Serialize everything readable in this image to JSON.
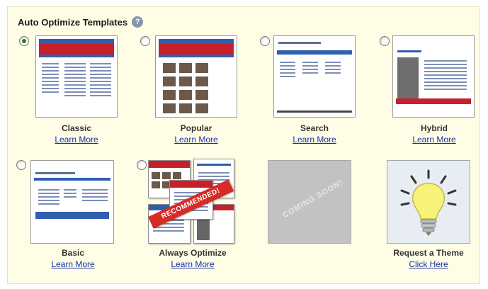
{
  "panel": {
    "title": "Auto Optimize Templates",
    "help_icon_glyph": "?"
  },
  "templates": [
    {
      "name": "Classic",
      "link": "Learn More",
      "selected": true
    },
    {
      "name": "Popular",
      "link": "Learn More",
      "selected": false
    },
    {
      "name": "Search",
      "link": "Learn More",
      "selected": false
    },
    {
      "name": "Hybrid",
      "link": "Learn More",
      "selected": false
    },
    {
      "name": "Basic",
      "link": "Learn More",
      "selected": false
    },
    {
      "name": "Always Optimize",
      "link": "Learn More",
      "selected": false,
      "ribbon": "RECOMMENDED!"
    },
    {
      "name": "",
      "link": "",
      "placeholder": "COMING SOON!"
    },
    {
      "name": "Request a Theme",
      "link": "Click Here"
    }
  ],
  "colors": {
    "panel_bg": "#fffde6",
    "link": "#1533a8",
    "header_red": "#c8202b",
    "header_blue": "#2f5fae",
    "ribbon_red": "#d82b25"
  }
}
